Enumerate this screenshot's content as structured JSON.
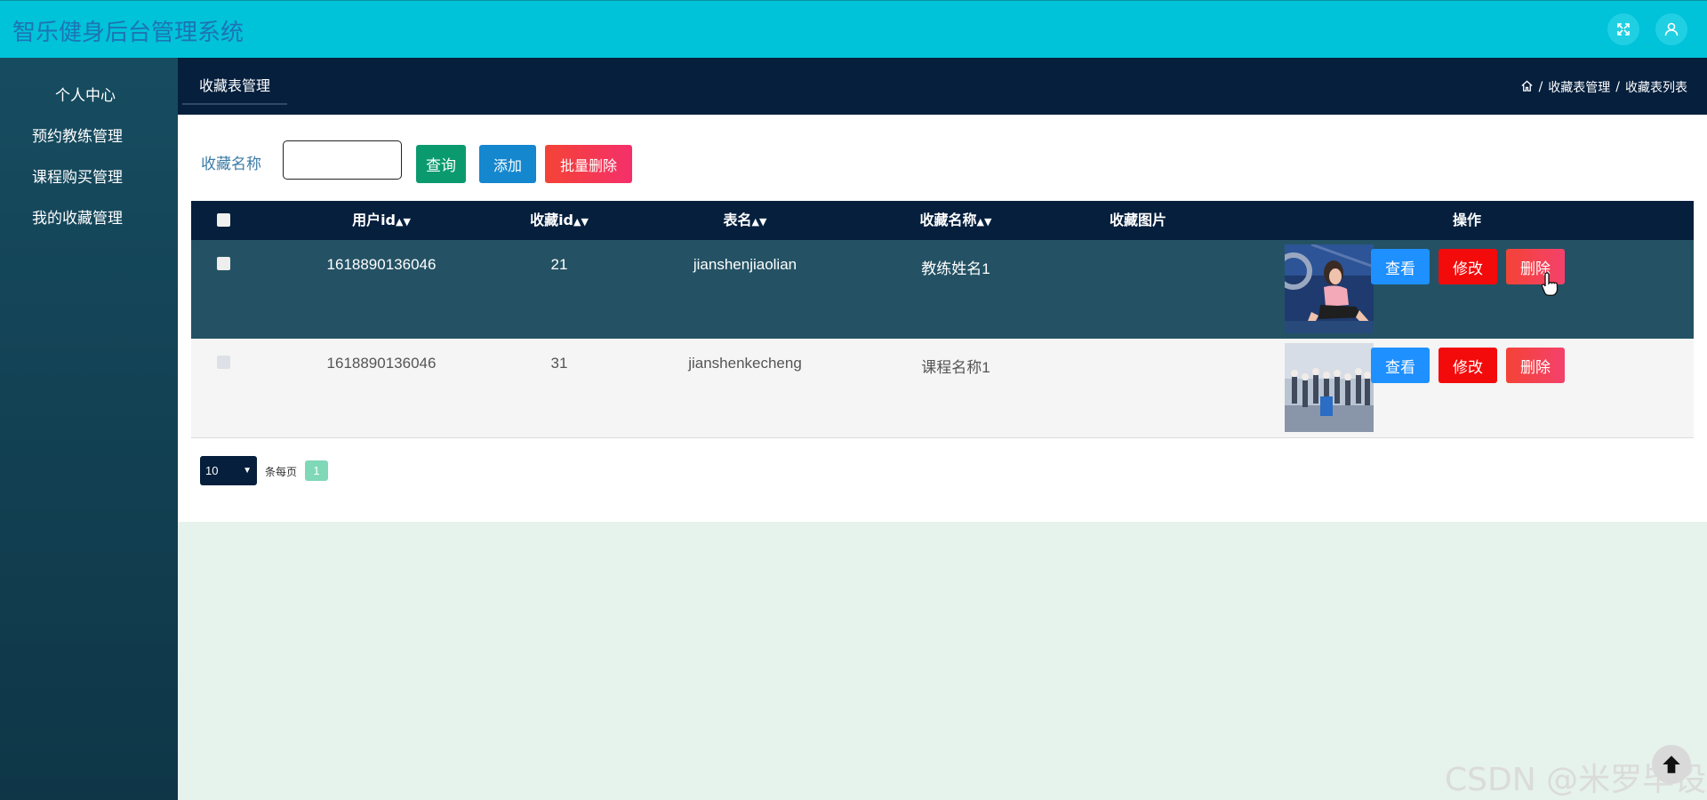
{
  "app": {
    "title": "智乐健身后台管理系统"
  },
  "topbar": {
    "icons": [
      "fullscreen-icon",
      "user-icon"
    ],
    "accent": "#00c2d9"
  },
  "sidebar": {
    "items": [
      {
        "label": "个人中心"
      },
      {
        "label": "预约教练管理"
      },
      {
        "label": "课程购买管理"
      },
      {
        "label": "我的收藏管理"
      }
    ]
  },
  "header": {
    "tab": "收藏表管理",
    "breadcrumb": [
      "收藏表管理",
      "收藏表列表"
    ],
    "breadcrumb_sep": "/"
  },
  "search": {
    "label": "收藏名称",
    "value": "",
    "query_label": "查询",
    "add_label": "添加",
    "batch_delete_label": "批量删除"
  },
  "table": {
    "columns": [
      "用户id",
      "收藏id",
      "表名",
      "收藏名称",
      "收藏图片",
      "操作"
    ],
    "rows": [
      {
        "userid": "1618890136046",
        "refid": "21",
        "tablename": "jianshenjiaolian",
        "name": "教练姓名1",
        "image": "coach-photo"
      },
      {
        "userid": "1618890136046",
        "refid": "31",
        "tablename": "jianshenkecheng",
        "name": "课程名称1",
        "image": "course-photo"
      }
    ],
    "actions": {
      "view": "查看",
      "edit": "修改",
      "delete": "删除"
    }
  },
  "pagination": {
    "page_size": "10",
    "per_page_label": "条每页",
    "current_page": "1"
  },
  "watermark": "CSDN @米罗毕设",
  "colors": {
    "navy": "#051f3d",
    "sidebar": "#174c60",
    "view": "#1e90ff",
    "edit": "#f30a0a",
    "delete": "#f44336",
    "query": "#0b9a6e",
    "add": "#1487cf"
  }
}
